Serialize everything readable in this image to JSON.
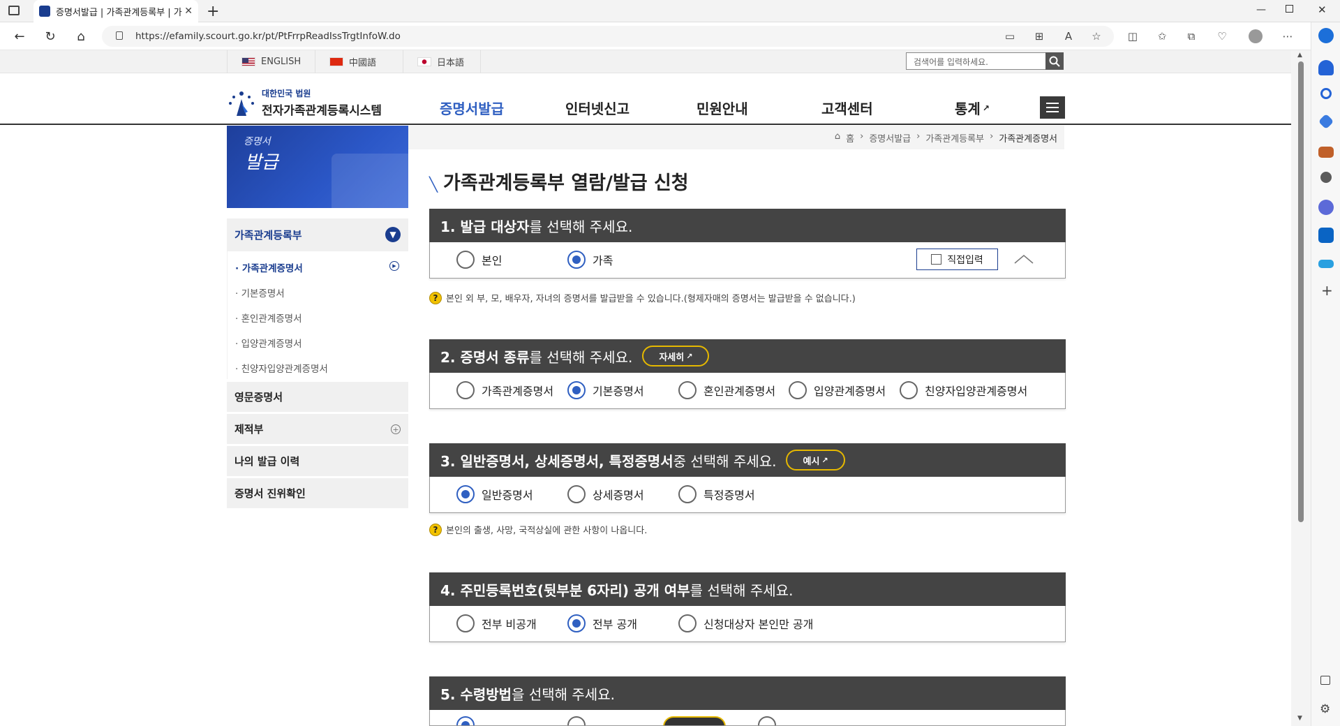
{
  "browser": {
    "tab_title": "증명서발급 | 가족관계등록부 | 가",
    "url": "https://efamily.scourt.go.kr/pt/PtFrrpReadIssTrgtInfoW.do"
  },
  "langbar": {
    "languages": [
      "ENGLISH",
      "中國語",
      "日本語"
    ],
    "search_placeholder": "검색어를 입력하세요."
  },
  "logo": {
    "line1": "대한민국 법원",
    "line2": "전자가족관계등록시스템"
  },
  "gnb": {
    "items": [
      "증명서발급",
      "인터넷신고",
      "민원안내",
      "고객센터",
      "통계"
    ]
  },
  "sidebar": {
    "banner_small": "증명서",
    "banner_big": "발급",
    "head": "가족관계등록부",
    "subitems": [
      "· 가족관계증명서",
      "· 기본증명서",
      "· 혼인관계증명서",
      "· 입양관계증명서",
      "· 친양자입양관계증명서"
    ],
    "items": [
      "영문증명서",
      "제적부",
      "나의 발급 이력",
      "증명서 진위확인"
    ]
  },
  "breadcrumb": [
    "홈",
    "증명서발급",
    "가족관계등록부",
    "가족관계증명서"
  ],
  "page_title": "가족관계등록부 열람/발급 신청",
  "sections": {
    "s1": {
      "title_bold": "1. 발급 대상자",
      "title_rest": "를 선택해 주세요.",
      "options": [
        "본인",
        "가족"
      ],
      "selected": "가족",
      "direct_label": "직접입력",
      "note": "본인 외 부, 모, 배우자, 자녀의 증명서를 발급받을 수 있습니다.(형제자매의 증명서는 발급받을 수 없습니다.)"
    },
    "s2": {
      "title_bold": "2. 증명서 종류",
      "title_rest": "를 선택해 주세요.",
      "pill": "자세히",
      "options": [
        "가족관계증명서",
        "기본증명서",
        "혼인관계증명서",
        "입양관계증명서",
        "친양자입양관계증명서"
      ],
      "selected": "기본증명서"
    },
    "s3": {
      "title_bold": "3. 일반증명서, 상세증명서, 특정증명서",
      "title_rest": " 중 선택해 주세요.",
      "pill": "예시",
      "options": [
        "일반증명서",
        "상세증명서",
        "특정증명서"
      ],
      "selected": "일반증명서",
      "note": "본인의 출생, 사망, 국적상실에 관한 사항이 나옵니다."
    },
    "s4": {
      "title_bold": "4. 주민등록번호(뒷부분 6자리) 공개 여부",
      "title_rest": "를 선택해 주세요.",
      "options": [
        "전부 비공개",
        "전부 공개",
        "신청대상자 본인만 공개"
      ],
      "selected": "전부 공개"
    },
    "s5": {
      "title_bold": "5. 수령방법",
      "title_rest": "을 선택해 주세요."
    }
  },
  "colors": {
    "accent": "#2f5fc1",
    "navy": "#1a3d8f",
    "header_bg": "#444444",
    "pill_border": "#e5b800"
  }
}
